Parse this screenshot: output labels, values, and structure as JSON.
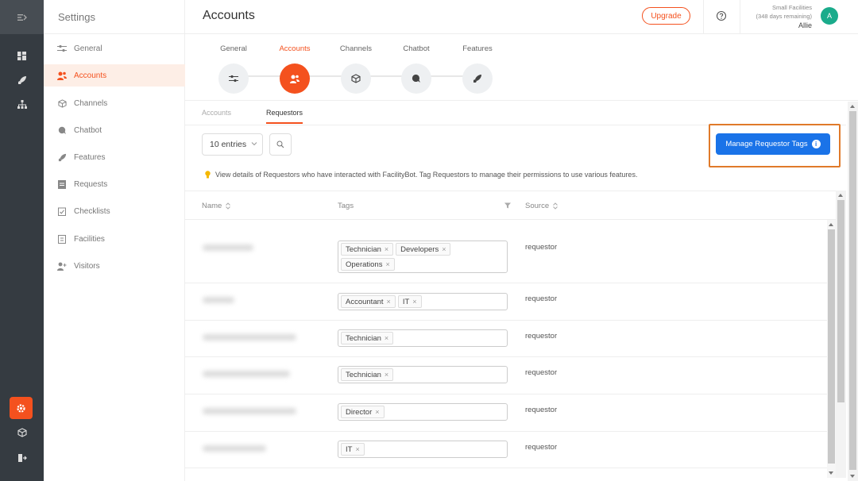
{
  "colors": {
    "accent": "#f4511e",
    "primary_button": "#1a73e8",
    "avatar": "#1aab8b",
    "rail": "#353b41"
  },
  "rail": {
    "icons": [
      "collapse-icon",
      "dashboard-icon",
      "rocket-icon",
      "facilities-tree-icon",
      "settings-gear-icon",
      "box-icon",
      "logout-icon"
    ]
  },
  "sidebar": {
    "title": "Settings",
    "items": [
      {
        "label": "General",
        "icon": "sliders-icon"
      },
      {
        "label": "Accounts",
        "icon": "users-icon"
      },
      {
        "label": "Channels",
        "icon": "box-icon"
      },
      {
        "label": "Chatbot",
        "icon": "chat-icon"
      },
      {
        "label": "Features",
        "icon": "rocket-icon"
      },
      {
        "label": "Requests",
        "icon": "clipboard-icon"
      },
      {
        "label": "Checklists",
        "icon": "checklist-icon"
      },
      {
        "label": "Facilities",
        "icon": "building-icon"
      },
      {
        "label": "Visitors",
        "icon": "visitor-icon"
      }
    ],
    "active": "Accounts"
  },
  "header": {
    "title": "Accounts",
    "upgrade_label": "Upgrade",
    "plan_name": "Small Facilities",
    "plan_days": "(348 days remaining)",
    "user_name": "Allie",
    "avatar_letter": "A"
  },
  "steps": [
    {
      "label": "General"
    },
    {
      "label": "Accounts"
    },
    {
      "label": "Channels"
    },
    {
      "label": "Chatbot"
    },
    {
      "label": "Features"
    }
  ],
  "subtabs": [
    {
      "label": "Accounts"
    },
    {
      "label": "Requestors"
    }
  ],
  "controls": {
    "entries_label": "10 entries",
    "manage_button_label": "Manage Requestor Tags",
    "info_text": "View details of Requestors who have interacted with FacilityBot. Tag Requestors to manage their permissions to use various features."
  },
  "table": {
    "headers": {
      "name": "Name",
      "tags": "Tags",
      "source": "Source"
    },
    "rows": [
      {
        "tags": [
          "Technician",
          "Developers",
          "Operations"
        ],
        "source": "requestor"
      },
      {
        "tags": [
          "Accountant",
          "IT"
        ],
        "source": "requestor"
      },
      {
        "tags": [
          "Technician"
        ],
        "source": "requestor"
      },
      {
        "tags": [
          "Technician"
        ],
        "source": "requestor"
      },
      {
        "tags": [
          "Director"
        ],
        "source": "requestor"
      },
      {
        "tags": [
          "IT"
        ],
        "source": "requestor"
      }
    ]
  }
}
